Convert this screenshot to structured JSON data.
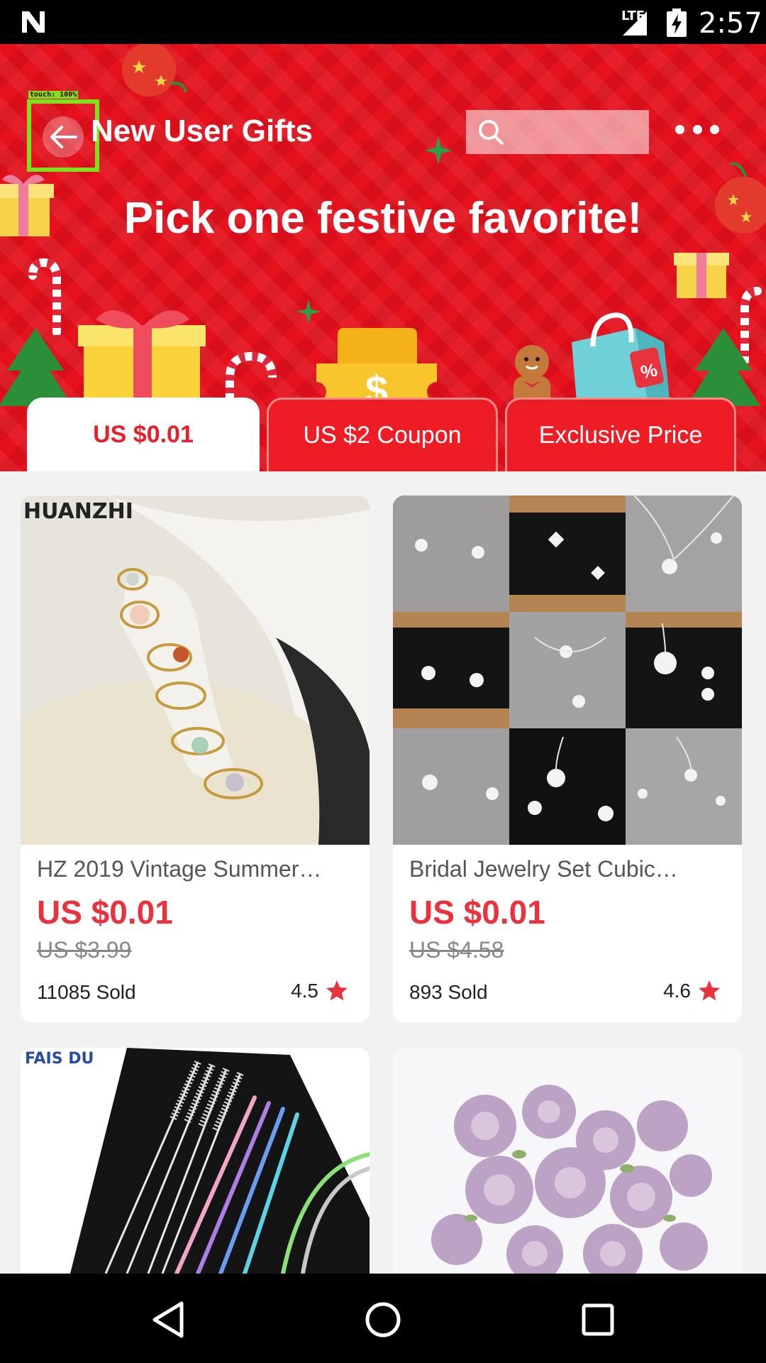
{
  "status_bar": {
    "network": "LTE",
    "time": "2:57"
  },
  "header": {
    "title": "New User Gifts",
    "touch_overlay": "touch: 100%",
    "search_placeholder": "",
    "headline": "Pick one festive favorite!"
  },
  "tabs": [
    {
      "label": "US $0.01",
      "active": true
    },
    {
      "label": "US $2 Coupon",
      "active": false
    },
    {
      "label": "Exclusive Price",
      "active": false
    }
  ],
  "products": [
    {
      "brand_overlay": "HUANZHI",
      "title": "HZ 2019 Vintage Summer…",
      "price": "US $0.01",
      "old_price": "US $3.99",
      "sold": "11085 Sold",
      "rating": "4.5"
    },
    {
      "title": "Bridal Jewelry Set Cubic…",
      "price": "US $0.01",
      "old_price": "US $4.58",
      "sold": "893 Sold",
      "rating": "4.6"
    },
    {
      "brand_overlay": "FAIS DU"
    },
    {}
  ],
  "colors": {
    "banner_red": "#e5121d",
    "price_red": "#e8333f",
    "star_red": "#e8333f",
    "touch_highlight": "#7ee11e"
  }
}
